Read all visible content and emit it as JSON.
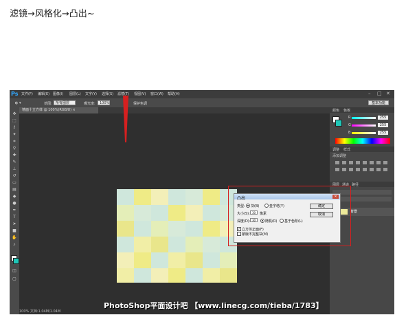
{
  "heading": "滤镜→风格化→凸出~",
  "ps": {
    "logo": "Ps",
    "menus": [
      "文件(F)",
      "编辑(E)",
      "图像(I)",
      "图层(L)",
      "文字(Y)",
      "选择(S)",
      "滤镜(T)",
      "视图(V)",
      "窗口(W)",
      "帮助(H)"
    ],
    "window_controls": [
      "–",
      "□",
      "✕"
    ],
    "options": {
      "mode_label": "范围:",
      "mode_value": "所有图层",
      "opacity_label": "曝光度:",
      "opacity_value": "100%",
      "protect_label": "保护色调",
      "workspace": "基本功能"
    },
    "doc_tab": "墙面十立方体 @ 100%(RGB/8) ×",
    "panels": {
      "color_tabs": [
        "颜色",
        "色板"
      ],
      "sliders": [
        {
          "label": "R",
          "value": "255"
        },
        {
          "label": "G",
          "value": "255"
        },
        {
          "label": "B",
          "value": "255"
        }
      ],
      "adjust_tabs": [
        "调整",
        "样式"
      ],
      "adjust_title": "添加调整",
      "layer_tabs": [
        "图层",
        "通道",
        "路径"
      ],
      "layer_name": "背景"
    },
    "status": "100%     文档:1.04M/1.04M"
  },
  "dialog": {
    "title": "凸出",
    "type_label": "类型:",
    "type_options": [
      "块(B)",
      "金字塔(Y)"
    ],
    "size_label": "大小(S):",
    "size_value": "30",
    "size_unit": "像素",
    "depth_label": "深度(D):",
    "depth_value": "30",
    "depth_options": [
      "随机(R)",
      "基于色阶(L)"
    ],
    "checks": [
      "立方体正面(F)",
      "蒙版不完整块(M)"
    ],
    "ok": "确定",
    "cancel": "取消"
  },
  "watermark": "PhotoShop平面设计吧 【www.linecg.com/tieba/1783】",
  "colors": {
    "accent_red": "#d62020",
    "tile_yellow": "#efeb86",
    "tile_cyan": "#cfe7dc"
  }
}
